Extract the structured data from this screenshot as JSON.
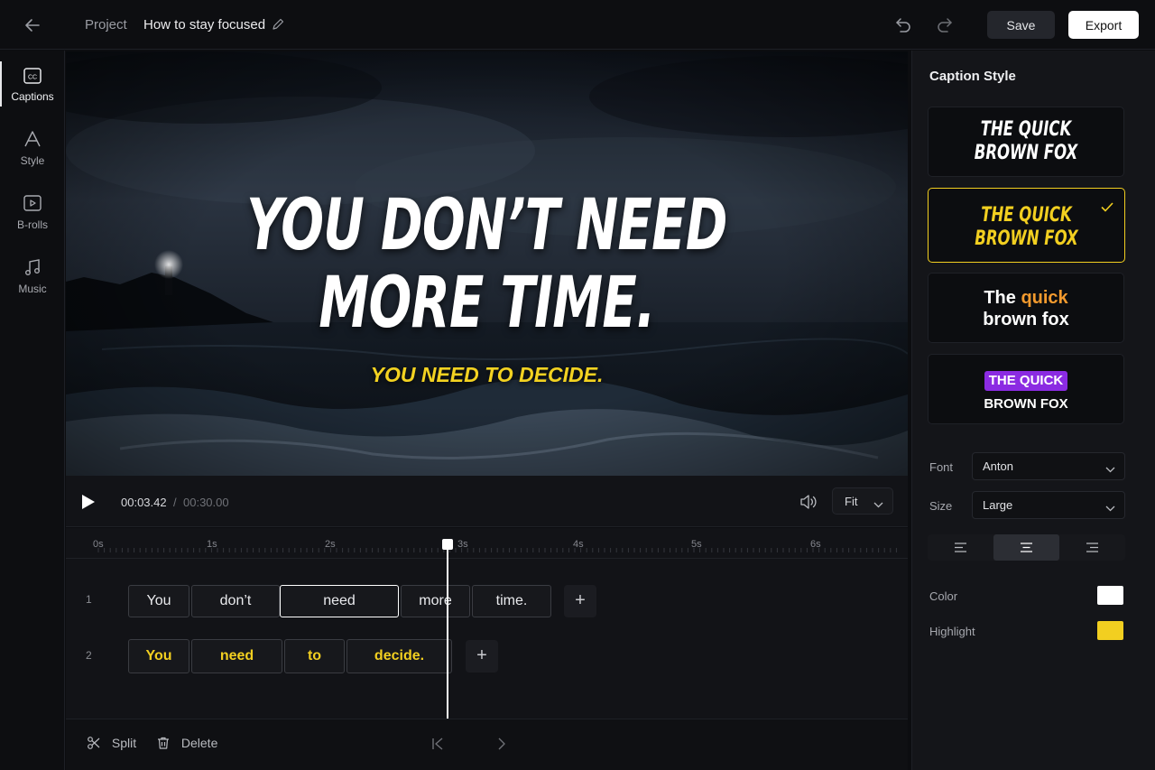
{
  "header": {
    "breadcrumb_root": "Project",
    "project_title": "How to stay focused",
    "save_label": "Save",
    "export_label": "Export"
  },
  "rail": {
    "items": [
      {
        "label": "Captions",
        "icon": "cc-icon",
        "active": true
      },
      {
        "label": "Style",
        "icon": "style-icon"
      },
      {
        "label": "B-rolls",
        "icon": "video-icon"
      },
      {
        "label": "Music",
        "icon": "music-icon"
      }
    ]
  },
  "preview": {
    "caption_line1": "YOU DON’T NEED",
    "caption_line2": "MORE TIME.",
    "caption_sub": "YOU NEED TO DECIDE."
  },
  "player": {
    "current_time": "00:03.42",
    "separator": "/",
    "total_time": "00:30.00",
    "fit_label": "Fit"
  },
  "timeline": {
    "ruler_labels": [
      "0s",
      "1s",
      "2s",
      "3s",
      "4s",
      "5s",
      "6s"
    ],
    "tracks": [
      {
        "number": "1",
        "words": [
          "You",
          "don’t",
          "need",
          "more",
          "time."
        ],
        "selected_index": 2,
        "color": "white"
      },
      {
        "number": "2",
        "words": [
          "You",
          "need",
          "to",
          "decide."
        ],
        "color": "yellow"
      }
    ],
    "add_label": "+"
  },
  "toolbar": {
    "split_label": "Split",
    "delete_label": "Delete"
  },
  "panel": {
    "title": "Caption Style",
    "cards": [
      {
        "line1": "THE QUICK",
        "line2": "BROWN FOX",
        "color": "#ffffff"
      },
      {
        "line1": "THE QUICK",
        "line2": "BROWN FOX",
        "color": "#f2cf20",
        "selected": true
      },
      {
        "pre": "The ",
        "highlight": "quick",
        "line2": "brown fox",
        "highlight_color": "#f39a2e"
      },
      {
        "pill": "THE QUICK",
        "line2": "BROWN FOX",
        "pill_color": "#8b2be2"
      }
    ],
    "font_label": "Font",
    "font_value": "Anton",
    "size_label": "Size",
    "size_value": "Large",
    "alignment": "center",
    "color_label": "Color",
    "color_value": "#ffffff",
    "highlight_label": "Highlight",
    "highlight_value": "#f2cf20"
  },
  "colors": {
    "accent_yellow": "#f2cf20",
    "background": "#0c0d10"
  }
}
